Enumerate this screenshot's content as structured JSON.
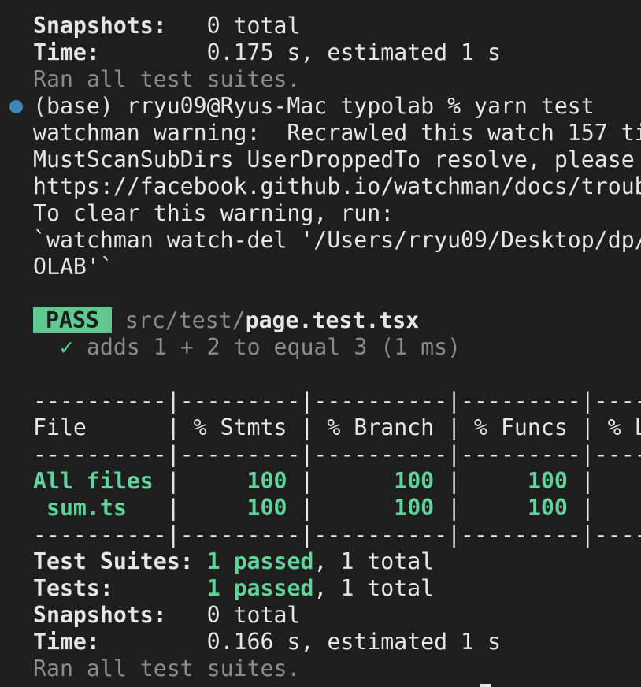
{
  "summary_top": {
    "snapshots_label": "Snapshots:",
    "snapshots_value": "0 total",
    "time_label": "Time:",
    "time_value": "0.175 s, estimated 1 s",
    "ran_all": "Ran all test suites."
  },
  "prompt": {
    "text": "(base) rryu09@Ryus-Mac typolab % yarn test"
  },
  "watchman": {
    "line1": "watchman warning:  Recrawled this watch 157 ti",
    "line2": "MustScanSubDirs UserDroppedTo resolve, please",
    "line3": "https://facebook.github.io/watchman/docs/troub",
    "line4": "To clear this warning, run:",
    "line5": "`watchman watch-del '/Users/rryu09/Desktop/dp/",
    "line6": "OLAB'`"
  },
  "test_result": {
    "badge": "PASS",
    "path_dir": "src/test/",
    "path_file": "page.test.tsx",
    "check": "✓",
    "case": "adds 1 + 2 to equal 3 (1 ms)"
  },
  "coverage": {
    "separator": "----------|---------|----------|---------|----",
    "header": "File      | % Stmts | % Branch | % Funcs | % L",
    "rows": [
      {
        "file": "All files",
        "stmts": "100",
        "branch": "100",
        "funcs": "100"
      },
      {
        "file": " sum.ts",
        "stmts": "100",
        "branch": "100",
        "funcs": "100"
      }
    ]
  },
  "summary_bottom": {
    "suites_label": "Test Suites:",
    "suites_passed": "1 passed",
    "suites_total": ", 1 total",
    "tests_label": "Tests:",
    "tests_passed": "1 passed",
    "tests_total": ", 1 total",
    "snapshots_label": "Snapshots:",
    "snapshots_value": "0 total",
    "time_label": "Time:",
    "time_value": "0.166 s, estimated 1 s",
    "ran_all": "Ran all test suites."
  },
  "colors": {
    "background": "#1e1e1e",
    "foreground": "#e6e6e6",
    "pass": "#5fd49a",
    "dim": "#8b8b8b",
    "prompt_dot": "#3b87b8"
  }
}
